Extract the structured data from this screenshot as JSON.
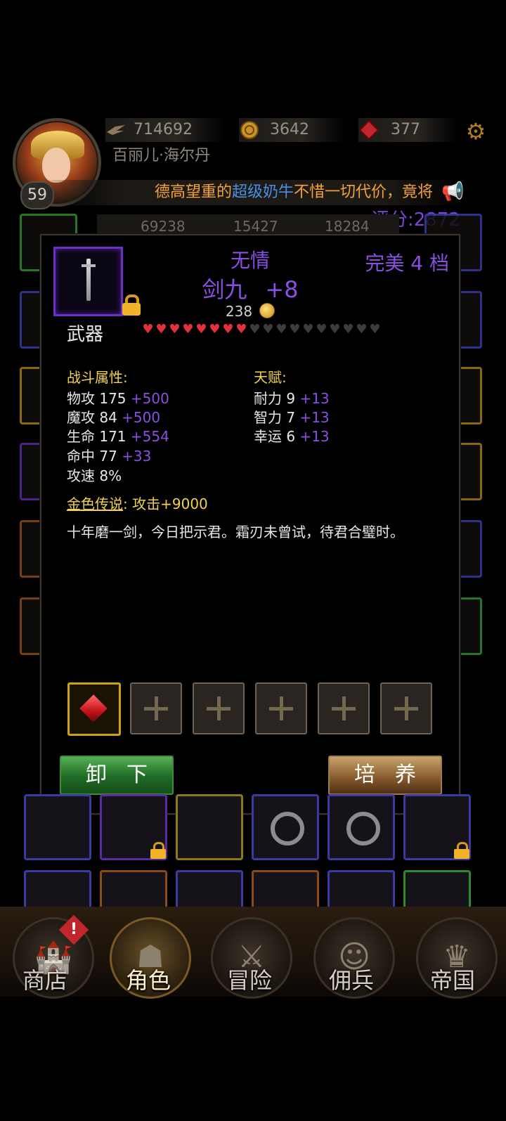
{
  "header": {
    "level": "59",
    "player_name": "百丽儿·海尔丹",
    "resources": [
      {
        "name": "wings-icon",
        "value": "714692"
      },
      {
        "name": "gold-coin-icon",
        "value": "3642"
      },
      {
        "name": "red-gem-icon",
        "value": "377"
      }
    ],
    "marquee": [
      {
        "text": "德高望重的",
        "color": "#f2a23a"
      },
      {
        "text": "超级奶牛",
        "color": "#4a8fe6"
      },
      {
        "text": "不惜一切代价，竟将",
        "color": "#f2a23a"
      }
    ],
    "score": "评分:2872",
    "bg_stats": [
      "69238",
      "15427",
      "18284"
    ]
  },
  "item": {
    "name": "无情",
    "title": "剑九",
    "enhance": "+8",
    "quality": "完美 4 档",
    "price": "238",
    "slot_type": "武器",
    "hearts_total": 18,
    "hearts_filled": 8,
    "combat_title": "战斗属性:",
    "combat_stats": [
      {
        "label": "物攻 175",
        "bonus": "+500"
      },
      {
        "label": "魔攻 84",
        "bonus": "+500"
      },
      {
        "label": "生命 171",
        "bonus": "+554"
      },
      {
        "label": "命中 77",
        "bonus": "+33"
      },
      {
        "label": "攻速 8%",
        "bonus": ""
      }
    ],
    "talent_title": "天赋:",
    "talent_stats": [
      {
        "label": "耐力 9",
        "bonus": "+13"
      },
      {
        "label": "智力 7",
        "bonus": "+13"
      },
      {
        "label": "幸运 6",
        "bonus": "+13"
      }
    ],
    "legend_label": "金色传说",
    "legend_sep": ":",
    "legend_effect": "攻击+9000",
    "flavor": "十年磨一剑，今日把示君。霜刃未曾试，待君合璧时。",
    "gem_slots": [
      "red-gem",
      "empty",
      "empty",
      "empty",
      "empty",
      "empty"
    ],
    "unequip_label": "卸下",
    "train_label": "培养"
  },
  "nav": [
    {
      "label": "商店",
      "alert": "!"
    },
    {
      "label": "角色"
    },
    {
      "label": "冒险"
    },
    {
      "label": "佣兵"
    },
    {
      "label": "帝国"
    }
  ]
}
